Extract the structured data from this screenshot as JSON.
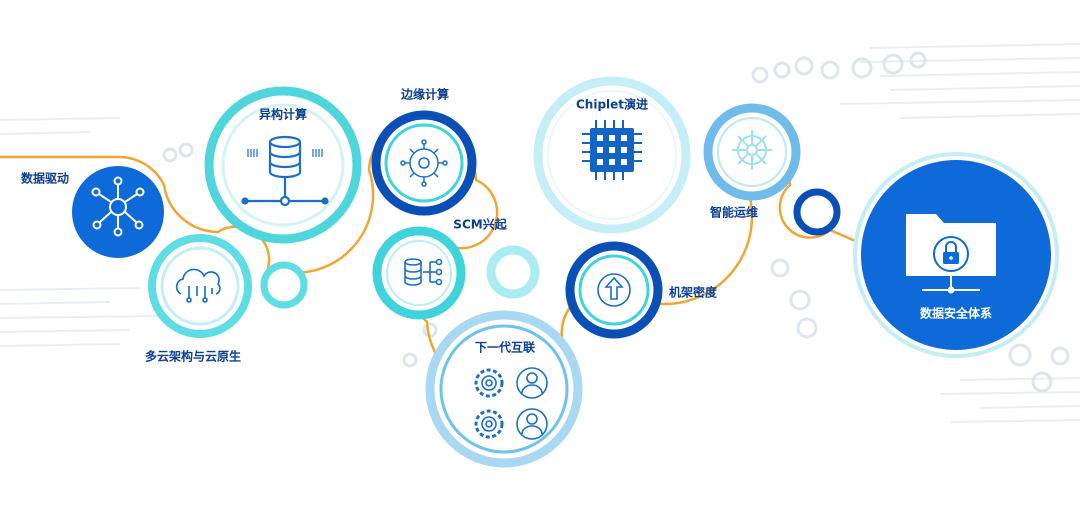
{
  "colors": {
    "primary_blue": "#0e6ad8",
    "deep_blue": "#0a4fb5",
    "cyan": "#3fd4dc",
    "light_cyan": "#a9ecf2",
    "orange_line": "#f0a534",
    "label_blue": "#0d4fb3",
    "label_dark": "#0b3f8f"
  },
  "nodes": {
    "data_driven": {
      "label": "数据驱动",
      "icon": "network-hub-icon"
    },
    "multicloud": {
      "label": "多云架构与云原生",
      "icon": "cloud-circuit-icon"
    },
    "heterogeneous": {
      "label": "异构计算",
      "icon": "database-server-icon"
    },
    "edge": {
      "label": "边缘计算",
      "icon": "edge-network-icon"
    },
    "scm": {
      "label": "SCM兴起",
      "icon": "storage-stack-icon"
    },
    "next_interconnect": {
      "label": "下一代互联",
      "icon": "gear-user-icon"
    },
    "chiplet": {
      "label": "Chiplet演进",
      "icon": "chip-icon"
    },
    "rack_density": {
      "label": "机架密度",
      "icon": "upload-arrow-icon"
    },
    "intelligent_ops": {
      "label": "智能运维",
      "icon": "snowflake-gear-icon"
    },
    "security": {
      "label": "数据安全体系",
      "icon": "folder-lock-icon"
    }
  }
}
